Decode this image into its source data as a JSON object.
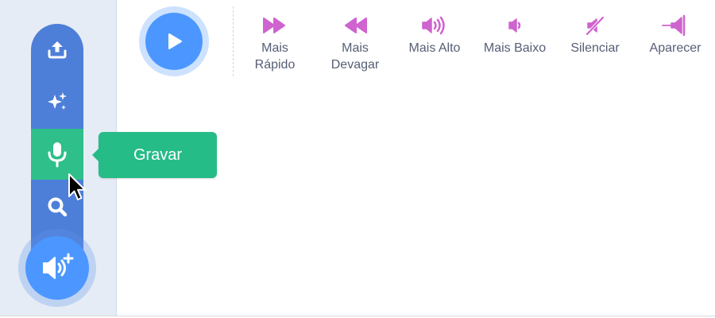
{
  "sidebar": {
    "menu_items": [
      {
        "icon": "upload-icon",
        "label": ""
      },
      {
        "icon": "surprise-sparkle-icon",
        "label": ""
      },
      {
        "icon": "microphone-icon",
        "label": "",
        "active": true
      },
      {
        "icon": "search-icon",
        "label": ""
      }
    ],
    "add_sound_button": {
      "icon": "speaker-add-icon"
    },
    "tooltip": {
      "text": "Gravar"
    }
  },
  "toolbar": {
    "play_button": {
      "icon": "play-icon"
    },
    "effects": [
      {
        "icon": "fast-forward-icon",
        "label_line1": "Mais",
        "label_line2": "Rápido"
      },
      {
        "icon": "rewind-icon",
        "label_line1": "Mais",
        "label_line2": "Devagar"
      },
      {
        "icon": "volume-up-icon",
        "label_line1": "Mais Alto",
        "label_line2": ""
      },
      {
        "icon": "volume-down-icon",
        "label_line1": "Mais Baixo",
        "label_line2": ""
      },
      {
        "icon": "mute-icon",
        "label_line1": "Silenciar",
        "label_line2": ""
      },
      {
        "icon": "fade-in-icon",
        "label_line1": "Aparecer",
        "label_line2": ""
      }
    ]
  },
  "colors": {
    "menu_blue": "#4d7fd8",
    "active_green": "#2fbf8a",
    "tooltip_green": "#26bc88",
    "play_blue": "#4c97ff",
    "effect_magenta": "#cf63cf",
    "label_gray": "#575e75",
    "panel_bg": "#e6ecf5"
  }
}
